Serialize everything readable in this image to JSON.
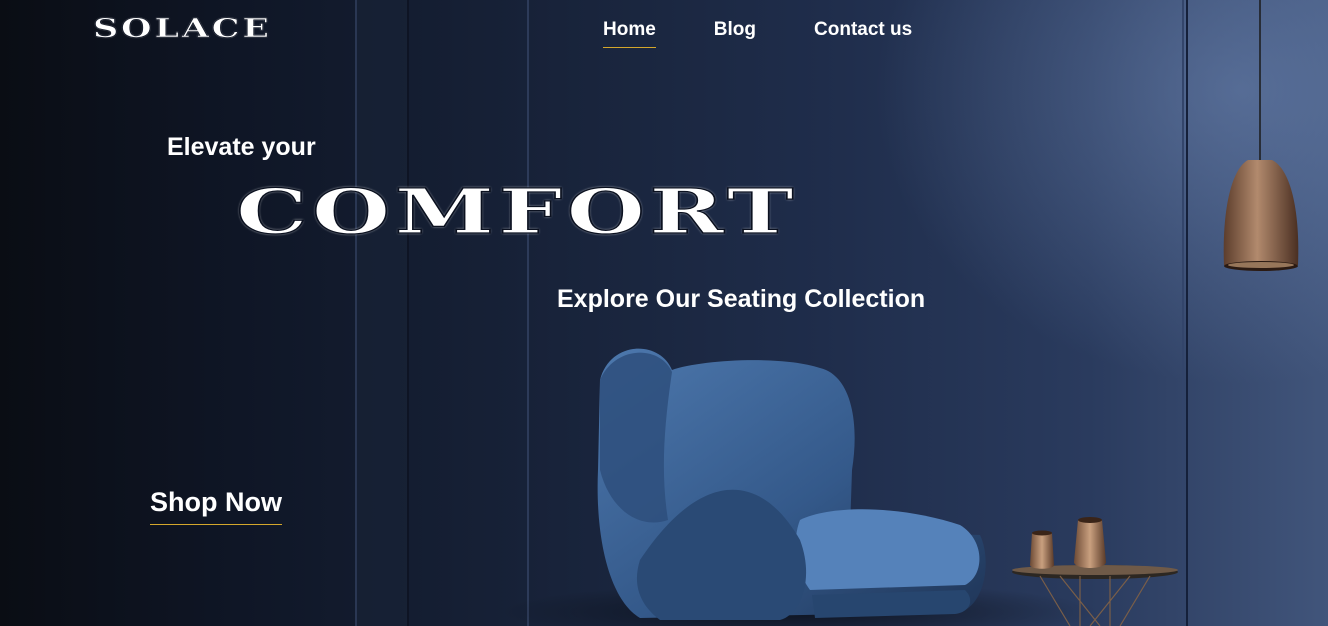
{
  "brand": {
    "logo_text": "SOLACE"
  },
  "nav": {
    "items": [
      {
        "label": "Home",
        "active": true
      },
      {
        "label": "Blog",
        "active": false
      },
      {
        "label": "Contact us",
        "active": false
      }
    ]
  },
  "hero": {
    "eyebrow": "Elevate your",
    "headline": "COMFORT",
    "subline": "Explore Our Seating Collection",
    "cta_label": "Shop Now",
    "illustration": [
      "armchair",
      "pendant-lamp",
      "side-table",
      "vases"
    ]
  },
  "colors": {
    "accent_underline": "#d4a72c",
    "text": "#ffffff",
    "wall": "#1f2d4b",
    "chair": "#3d6aa0",
    "copper": "#9a6b4a"
  }
}
